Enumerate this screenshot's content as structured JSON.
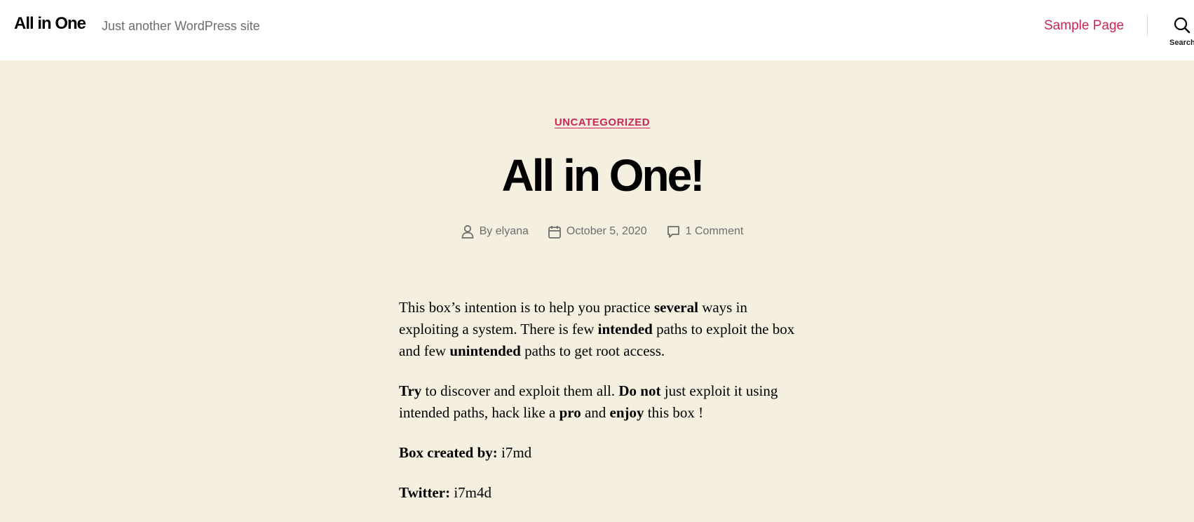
{
  "header": {
    "site_title": "All in One",
    "site_description": "Just another WordPress site",
    "nav": [
      {
        "label": "Sample Page"
      }
    ],
    "search_label": "Search"
  },
  "post": {
    "category": "UNCATEGORIZED",
    "title": "All in One!",
    "meta": {
      "author_prefix": "By ",
      "author": "elyana",
      "date": "October 5, 2020",
      "comments": "1 Comment"
    },
    "paragraph1": {
      "t1": "This box’s intention is to help you practice ",
      "b1": "several",
      "t2": " ways in exploiting a system. There is few ",
      "b2": "intended",
      "t3": " paths to exploit the box and few ",
      "b3": "unintended",
      "t4": " paths to get root access."
    },
    "paragraph2": {
      "b1": "Try",
      "t1": " to discover and exploit them all. ",
      "b2": "Do not",
      "t2": " just exploit it using intended paths, hack like a ",
      "b3": "pro",
      "t3": " and ",
      "b4": "enjoy",
      "t4": " this box !"
    },
    "created_by": {
      "label": "Box created by:",
      "value": " i7md"
    },
    "twitter": {
      "label": "Twitter:",
      "value": " i7m4d"
    }
  },
  "colors": {
    "accent": "#cd2653",
    "background": "#f5efe0",
    "header_bg": "#ffffff",
    "meta_text": "#6d6d6d"
  },
  "icons": [
    "user-icon",
    "calendar-icon",
    "comment-icon",
    "search-icon"
  ]
}
